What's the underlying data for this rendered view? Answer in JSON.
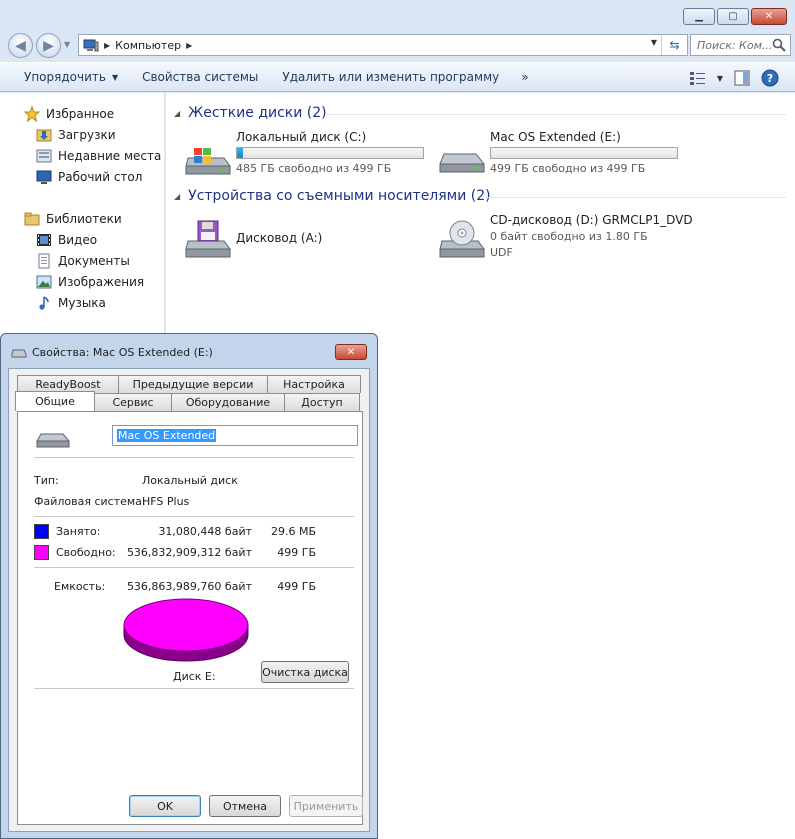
{
  "explorer": {
    "address": {
      "segment": "Компьютер"
    },
    "search": {
      "placeholder": "Поиск: Ком..."
    },
    "toolbar": {
      "organize": "Упорядочить",
      "system_props": "Свойства системы",
      "uninstall": "Удалить или изменить программу",
      "more": "»"
    },
    "nav": {
      "favorites": "Избранное",
      "downloads": "Загрузки",
      "recent": "Недавние места",
      "desktop": "Рабочий стол",
      "libraries": "Библиотеки",
      "video": "Видео",
      "documents": "Документы",
      "pictures": "Изображения",
      "music": "Музыка"
    },
    "groups": {
      "hdd": "Жесткие диски (2)",
      "removable": "Устройства со съемными носителями (2)"
    },
    "drives": {
      "c": {
        "name": "Локальный диск (C:)",
        "free": "485 ГБ свободно из 499 ГБ",
        "used_fraction": 0.03
      },
      "e": {
        "name": "Mac OS Extended (E:)",
        "free": "499 ГБ свободно из 499 ГБ",
        "used_fraction": 0.0
      },
      "a": {
        "name": "Дисковод (A:)"
      },
      "d": {
        "name": "CD-дисковод (D:) GRMCLP1_DVD",
        "free": "0 байт свободно из 1.80 ГБ",
        "fs": "UDF"
      }
    }
  },
  "dialog": {
    "title": "Свойства: Mac OS Extended (E:)",
    "tabs_back": [
      "ReadyBoost",
      "Предыдущие версии",
      "Настройка"
    ],
    "tabs_front": [
      "Общие",
      "Сервис",
      "Оборудование",
      "Доступ"
    ],
    "name_value": "Mac OS Extended",
    "type_label": "Тип:",
    "type_value": "Локальный диск",
    "fs_label": "Файловая система:",
    "fs_value": "HFS Plus",
    "used_label": "Занято:",
    "used_bytes": "31,080,448 байт",
    "used_size": "29.6 МБ",
    "free_label": "Свободно:",
    "free_bytes": "536,832,909,312 байт",
    "free_size": "499 ГБ",
    "capacity_label": "Емкость:",
    "capacity_bytes": "536,863,989,760 байт",
    "capacity_size": "499 ГБ",
    "disk_label": "Диск E:",
    "cleanup_button": "Очистка диска",
    "ok_button": "OK",
    "cancel_button": "Отмена",
    "apply_button": "Применить",
    "colors": {
      "used": "#0000ff",
      "free": "#ff00ff"
    }
  }
}
